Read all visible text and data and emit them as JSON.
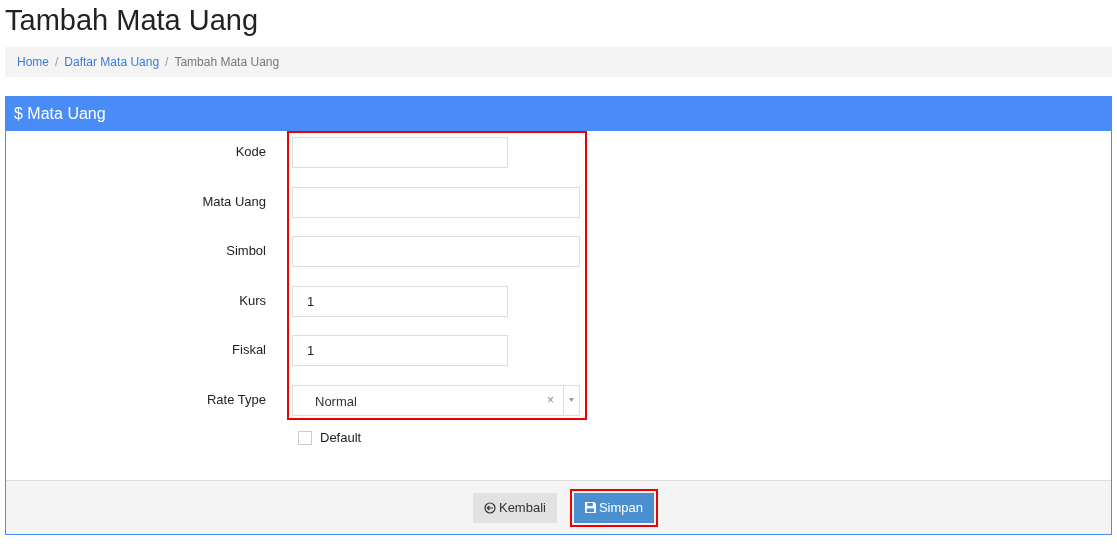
{
  "title": "Tambah Mata Uang",
  "breadcrumb_separator": "/",
  "breadcrumb": [
    {
      "label": "Home",
      "current": false
    },
    {
      "label": "Daftar Mata Uang",
      "current": false
    },
    {
      "label": "Tambah Mata Uang",
      "current": true
    }
  ],
  "panel": {
    "icon": "$",
    "title": "Mata Uang"
  },
  "form": {
    "highlighted": true,
    "fields": [
      {
        "kind": "text",
        "label": "Kode",
        "wide": false
      },
      {
        "kind": "text",
        "label": "Mata Uang",
        "wide": true
      },
      {
        "kind": "text",
        "label": "Simbol",
        "wide": true
      },
      {
        "kind": "text",
        "label": "Kurs",
        "value": "1",
        "wide": false
      },
      {
        "kind": "text",
        "label": "Fiskal",
        "value": "1",
        "wide": false
      },
      {
        "kind": "select",
        "label": "Rate Type",
        "value": "Normal",
        "clear": "×",
        "wide": true
      }
    ]
  },
  "checkbox": {
    "label": "Default",
    "checked": false
  },
  "buttons": [
    {
      "kind": "back",
      "label": "Kembali",
      "highlighted": false
    },
    {
      "kind": "save",
      "label": "Simpan",
      "highlighted": true
    }
  ]
}
